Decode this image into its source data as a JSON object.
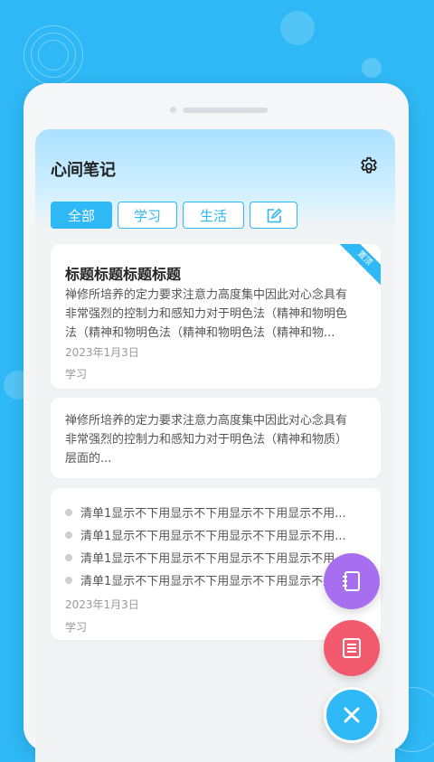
{
  "app": {
    "title": "心间笔记"
  },
  "tabs": [
    {
      "label": "全部",
      "active": true
    },
    {
      "label": "学习",
      "active": false
    },
    {
      "label": "生活",
      "active": false
    },
    {
      "label": "",
      "icon": "edit-icon",
      "active": false
    }
  ],
  "notes": [
    {
      "title": "标题标题标题标题",
      "pinned_badge": "置顶",
      "body": [
        "禅修所培养的定力要求注意力高度集中因此对心念具有",
        "非常强烈的控制力和感知力对于明色法（精神和物明色",
        "法（精神和物明色法（精神和物明色法（精神和物..."
      ],
      "date": "2023年1月3日",
      "tag": "学习"
    },
    {
      "body": [
        "禅修所培养的定力要求注意力高度集中因此对心念具有",
        "非常强烈的控制力和感知力对于明色法（精神和物质）",
        "层面的..."
      ]
    },
    {
      "checklist": [
        "清单1显示不下用显示不下用显示不下用显示不用...",
        "清单1显示不下用显示不下用显示不下用显示不用...",
        "清单1显示不下用显示不下用显示不下用显示不用...",
        "清单1显示不下用显示不下用显示不下用显示不用..."
      ],
      "date": "2023年1月3日",
      "tag": "学习"
    }
  ],
  "fab": [
    {
      "name": "notebook-icon",
      "color": "#a86ef0"
    },
    {
      "name": "list-icon",
      "color": "#f25a6e"
    },
    {
      "name": "close-icon",
      "color": "#2eb8f5"
    }
  ],
  "colors": {
    "accent": "#2eb8f5",
    "background": "#2eb8f5"
  }
}
